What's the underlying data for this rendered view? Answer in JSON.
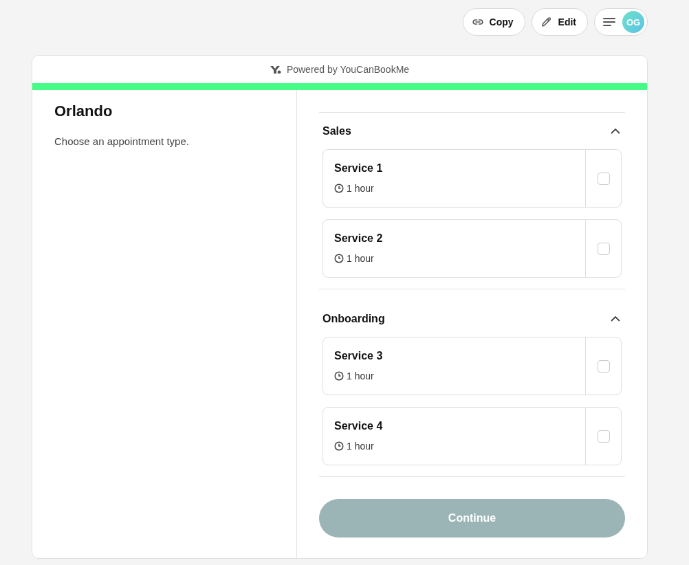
{
  "toolbar": {
    "copy_label": "Copy",
    "edit_label": "Edit",
    "avatar_initials": "OG"
  },
  "card": {
    "powered_by": "Powered by YouCanBookMe",
    "title": "Orlando",
    "subtitle": "Choose an appointment type."
  },
  "sections": [
    {
      "title": "Sales",
      "expanded": true,
      "services": [
        {
          "name": "Service 1",
          "duration": "1 hour",
          "checked": false
        },
        {
          "name": "Service 2",
          "duration": "1 hour",
          "checked": false
        }
      ]
    },
    {
      "title": "Onboarding",
      "expanded": true,
      "services": [
        {
          "name": "Service 3",
          "duration": "1 hour",
          "checked": false
        },
        {
          "name": "Service 4",
          "duration": "1 hour",
          "checked": false
        }
      ]
    }
  ],
  "continue_button": {
    "label": "Continue",
    "disabled": true
  }
}
